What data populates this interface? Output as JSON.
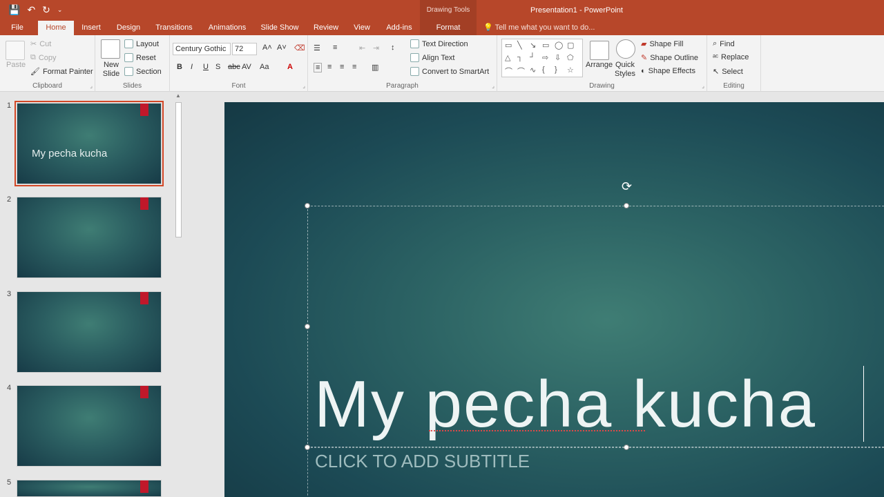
{
  "window": {
    "title": "Presentation1 - PowerPoint",
    "context_tools": "Drawing Tools"
  },
  "qat": {
    "save": "💾",
    "undo": "↶",
    "redo": "↻",
    "customize": "⌄"
  },
  "tabs": [
    {
      "label": "File"
    },
    {
      "label": "Home"
    },
    {
      "label": "Insert"
    },
    {
      "label": "Design"
    },
    {
      "label": "Transitions"
    },
    {
      "label": "Animations"
    },
    {
      "label": "Slide Show"
    },
    {
      "label": "Review"
    },
    {
      "label": "View"
    },
    {
      "label": "Add-ins"
    },
    {
      "label": "Format"
    }
  ],
  "tell_me": "Tell me what you want to do...",
  "ribbon": {
    "clipboard": {
      "label": "Clipboard",
      "paste": "Paste",
      "cut": "Cut",
      "copy": "Copy",
      "format_painter": "Format Painter"
    },
    "slides": {
      "label": "Slides",
      "new_slide": "New Slide",
      "layout": "Layout",
      "reset": "Reset",
      "section": "Section"
    },
    "font": {
      "label": "Font",
      "family": "Century Gothic",
      "size": "72"
    },
    "paragraph": {
      "label": "Paragraph",
      "text_direction": "Text Direction",
      "align_text": "Align Text",
      "convert_smartart": "Convert to SmartArt"
    },
    "drawing": {
      "label": "Drawing",
      "arrange": "Arrange",
      "quick_styles": "Quick Styles",
      "shape_fill": "Shape Fill",
      "shape_outline": "Shape Outline",
      "shape_effects": "Shape Effects"
    },
    "editing": {
      "label": "Editing",
      "find": "Find",
      "replace": "Replace",
      "select": "Select"
    }
  },
  "slides": [
    {
      "number": "1",
      "title": "My pecha kucha"
    },
    {
      "number": "2",
      "title": ""
    },
    {
      "number": "3",
      "title": ""
    },
    {
      "number": "4",
      "title": ""
    },
    {
      "number": "5",
      "title": ""
    }
  ],
  "main_slide": {
    "title": "My pecha kucha",
    "subtitle_placeholder": "CLICK TO ADD SUBTITLE"
  },
  "colors": {
    "brand": "#b7472a",
    "selection_outline": "#d24726"
  }
}
